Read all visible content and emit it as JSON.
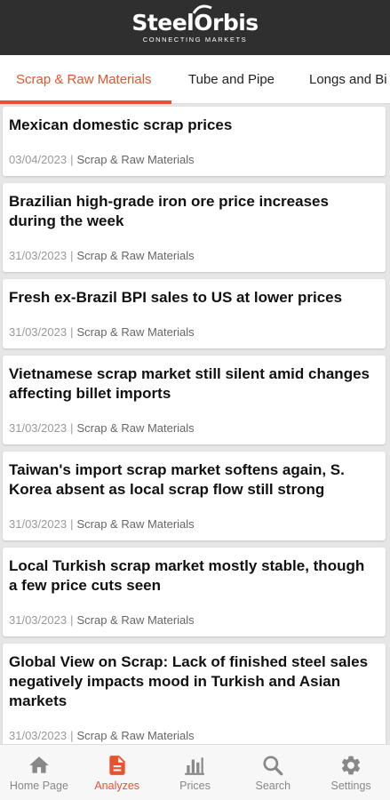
{
  "header": {
    "logo_text": "SteelOrbis",
    "logo_tagline": "CONNECTING MARKETS"
  },
  "tabs": [
    {
      "label": "Scrap & Raw Materials",
      "active": true
    },
    {
      "label": "Tube and Pipe",
      "active": false
    },
    {
      "label": "Longs and Bi",
      "active": false
    }
  ],
  "articles": [
    {
      "title": "Mexican domestic scrap prices",
      "date": "03/04/2023",
      "category": "Scrap & Raw Materials"
    },
    {
      "title": "Brazilian high-grade iron ore price increases during the week",
      "date": "31/03/2023",
      "category": "Scrap & Raw Materials"
    },
    {
      "title": "Fresh ex-Brazil BPI sales to US at lower prices",
      "date": "31/03/2023",
      "category": "Scrap & Raw Materials"
    },
    {
      "title": "Vietnamese scrap market still silent amid changes affecting billet imports",
      "date": "31/03/2023",
      "category": "Scrap & Raw Materials"
    },
    {
      "title": "Taiwan's import scrap market softens again, S. Korea absent as local scrap flow still strong",
      "date": "31/03/2023",
      "category": "Scrap & Raw Materials"
    },
    {
      "title": "Local Turkish scrap market mostly stable, though a few price cuts seen",
      "date": "31/03/2023",
      "category": "Scrap & Raw Materials"
    },
    {
      "title": "Global View on Scrap: Lack of finished steel sales negatively impacts mood in Turkish and Asian markets",
      "date": "31/03/2023",
      "category": "Scrap & Raw Materials"
    }
  ],
  "meta_separator": "|",
  "bottom_nav": [
    {
      "label": "Home Page",
      "icon": "home-icon",
      "active": false
    },
    {
      "label": "Analyzes",
      "icon": "document-icon",
      "active": true
    },
    {
      "label": "Prices",
      "icon": "bar-chart-icon",
      "active": false
    },
    {
      "label": "Search",
      "icon": "search-icon",
      "active": false
    },
    {
      "label": "Settings",
      "icon": "gear-icon",
      "active": false
    }
  ],
  "colors": {
    "accent": "#e8532f",
    "header_bg": "#2f2f2f"
  }
}
